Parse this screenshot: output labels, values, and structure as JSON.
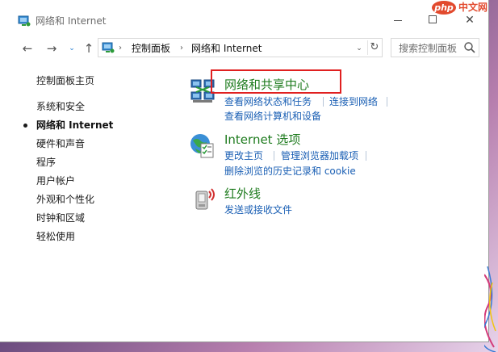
{
  "window": {
    "title": "网络和 Internet",
    "controls": {
      "minimize": "—",
      "maximize": "☐",
      "close": "✕"
    }
  },
  "watermark": {
    "logo": "php",
    "text": "中文网"
  },
  "nav": {
    "back": "←",
    "forward": "→",
    "recent": "⌄",
    "up": "↑"
  },
  "address": {
    "crumbs": [
      "控制面板",
      "网络和 Internet"
    ],
    "separator": "›",
    "dropdown": "⌄",
    "refresh": "↻"
  },
  "search": {
    "placeholder": "搜索控制面板"
  },
  "sidebar": {
    "items": [
      {
        "label": "控制面板主页"
      },
      {
        "label": "系统和安全"
      },
      {
        "label": "网络和 Internet"
      },
      {
        "label": "硬件和声音"
      },
      {
        "label": "程序"
      },
      {
        "label": "用户帐户"
      },
      {
        "label": "外观和个性化"
      },
      {
        "label": "时钟和区域"
      },
      {
        "label": "轻松使用"
      }
    ]
  },
  "main": {
    "categories": [
      {
        "title": "网络和共享中心",
        "icon": "network-sharing-icon",
        "links": [
          "查看网络状态和任务",
          "连接到网络",
          "查看网络计算机和设备"
        ]
      },
      {
        "title": "Internet 选项",
        "icon": "internet-options-icon",
        "links": [
          "更改主页",
          "管理浏览器加载项",
          "删除浏览的历史记录和 cookie"
        ]
      },
      {
        "title": "红外线",
        "icon": "infrared-icon",
        "links": [
          "发送或接收文件"
        ]
      }
    ]
  },
  "colors": {
    "category_title": "#1e7b1e",
    "link": "#1a5fb4",
    "highlight_border": "#e02020",
    "watermark": "#e24a2e"
  }
}
